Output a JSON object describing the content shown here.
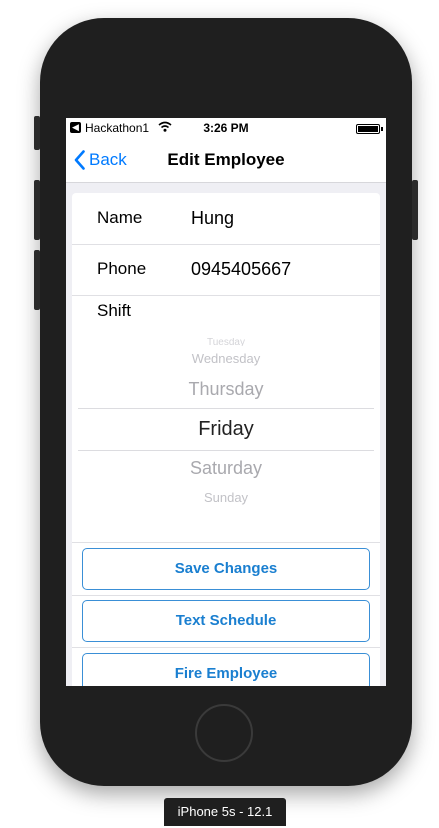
{
  "status_bar": {
    "back_glyph": "◀",
    "carrier": "Hackathon1",
    "time": "3:26 PM",
    "wifi_icon": "wifi-icon",
    "battery_icon": "battery-icon"
  },
  "nav": {
    "back_label": "Back",
    "title": "Edit Employee"
  },
  "form": {
    "name_label": "Name",
    "name_value": "Hung",
    "phone_label": "Phone",
    "phone_value": "0945405667",
    "shift_label": "Shift"
  },
  "picker": {
    "items": [
      "Tuesday",
      "Wednesday",
      "Thursday",
      "Friday",
      "Saturday",
      "Sunday"
    ],
    "selected": "Friday"
  },
  "actions": {
    "save": "Save Changes",
    "text_schedule": "Text Schedule",
    "fire": "Fire Employee"
  },
  "device_label": "iPhone 5s - 12.1",
  "colors": {
    "accent": "#007aff",
    "button_text": "#1a7fd0",
    "device_body": "#1f1f1f"
  }
}
